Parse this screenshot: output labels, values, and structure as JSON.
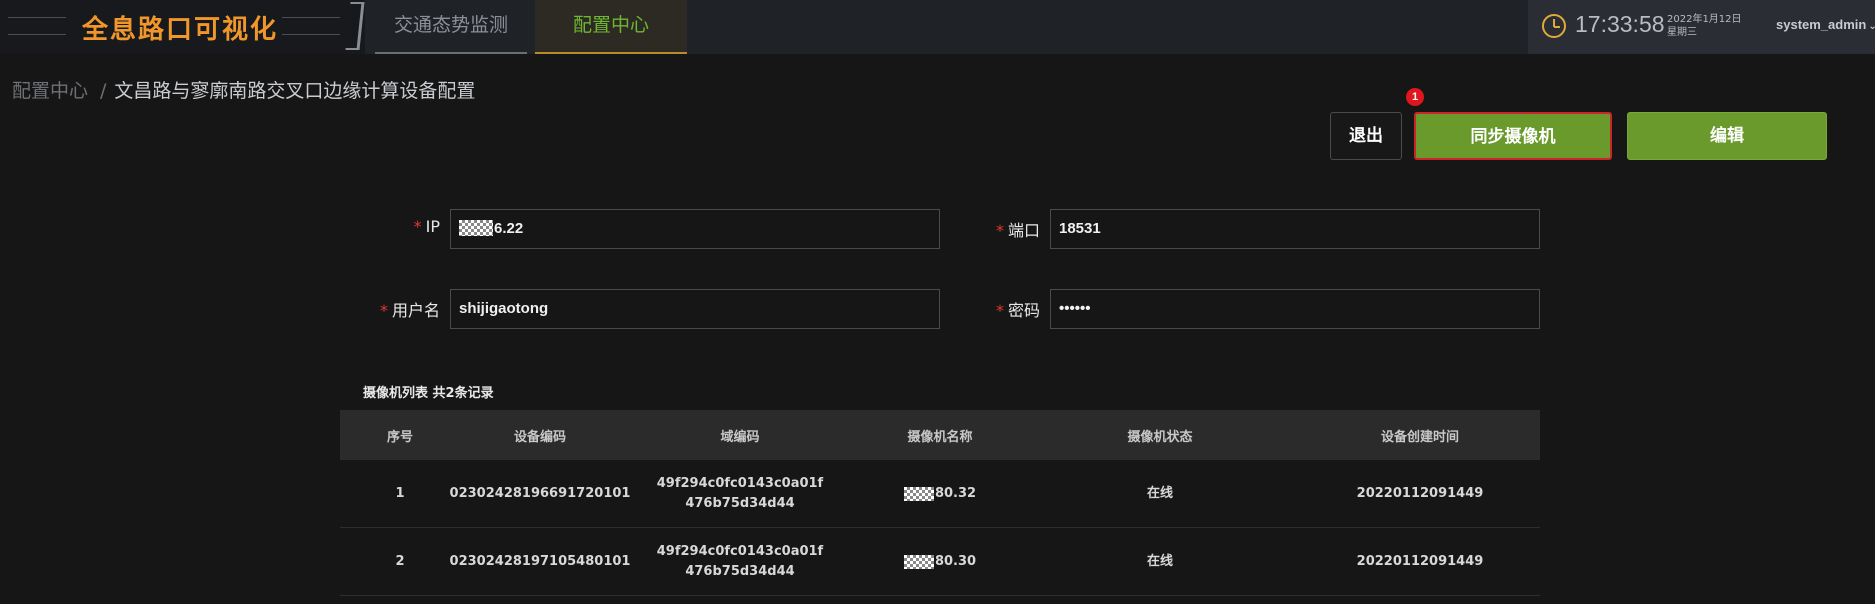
{
  "header": {
    "app_title": "全息路口可视化",
    "tabs": [
      {
        "label": "交通态势监测",
        "active": false
      },
      {
        "label": "配置中心",
        "active": true
      }
    ],
    "time": "17:33:58",
    "date": "2022年1月12日",
    "weekday": "星期三",
    "user": "system_admin",
    "user_chevron": "⌄"
  },
  "breadcrumb": {
    "root": "配置中心",
    "separator": "/",
    "current": "文昌路与寥廓南路交叉口边缘计算设备配置"
  },
  "actions": {
    "exit": "退出",
    "sync": "同步摄像机",
    "sync_badge": "1",
    "edit": "编辑"
  },
  "form": {
    "required_mark": "*",
    "ip_label": "IP",
    "ip_value": "6.22",
    "port_label": "端口",
    "port_value": "18531",
    "username_label": "用户名",
    "username_value": "shijigaotong",
    "password_label": "密码",
    "password_value": "••••••"
  },
  "camera_table": {
    "caption": "摄像机列表 共2条记录",
    "columns": [
      "序号",
      "设备编码",
      "域编码",
      "摄像机名称",
      "摄像机状态",
      "设备创建时间"
    ],
    "rows": [
      {
        "no": "1",
        "code": "02302428196691720101",
        "domain": "49f294c0fc0143c0a01f476b75d34d44",
        "name": "80.32",
        "state": "在线",
        "created": "20220112091449"
      },
      {
        "no": "2",
        "code": "02302428197105480101",
        "domain": "49f294c0fc0143c0a01f476b75d34d44",
        "name": "80.30",
        "state": "在线",
        "created": "20220112091449"
      }
    ]
  },
  "colors": {
    "accent_green": "#6a9a2c",
    "logo_orange": "#f0962a",
    "active_tab_text": "#6fb632",
    "required_red": "#e0392f",
    "badge_red": "#e0161f"
  },
  "icons": [
    "clock-icon",
    "chevron-down-icon"
  ]
}
